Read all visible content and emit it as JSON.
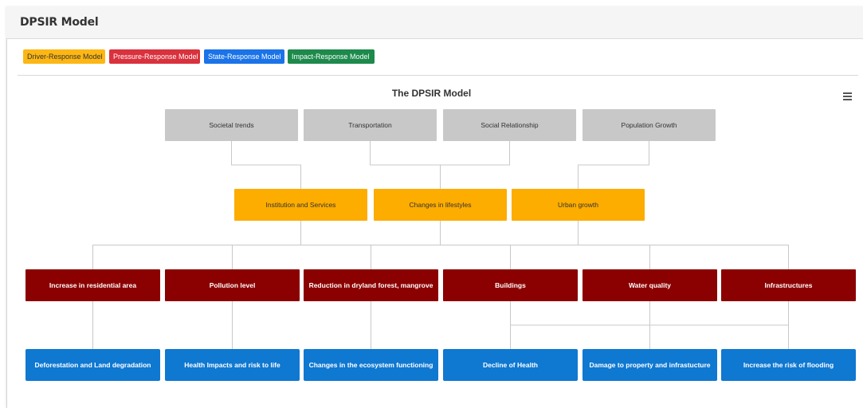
{
  "header": {
    "title": "DPSIR Model"
  },
  "toolbar": {
    "buttons": [
      {
        "label": "Driver-Response Model",
        "color": "#fdb714"
      },
      {
        "label": "Pressure-Response Model",
        "color": "#d9313d"
      },
      {
        "label": "State-Response Model",
        "color": "#1a73e8"
      },
      {
        "label": "Impact-Response Model",
        "color": "#1d8a4c"
      }
    ]
  },
  "chart": {
    "title": "The DPSIR Model",
    "menu_icon": "hamburger-menu-icon",
    "colors": {
      "drivers": "#c8c8c8",
      "pressures": "#fdac00",
      "states": "#8b0000",
      "impacts": "#0f78d1",
      "connector": "#c8c8c8"
    }
  },
  "chart_data": {
    "type": "organization",
    "levels": {
      "drivers": [
        "Societal trends",
        "Transportation",
        "Social Relationship",
        "Population Growth"
      ],
      "pressures": [
        "Institution and Services",
        "Changes in lifestyles",
        "Urban growth"
      ],
      "states": [
        "Increase in residential area",
        "Pollution level",
        "Reduction in dryland forest, mangrove",
        "Buildings",
        "Water quality",
        "Infrastructures"
      ],
      "impacts": [
        "Deforestation and Land degradation",
        "Health Impacts and risk to life",
        "Changes in the ecosystem functioning",
        "Decline of Health",
        "Damage to property and infrastucture",
        "Increase the risk of flooding"
      ]
    },
    "links": [
      [
        "Societal trends",
        "Institution and Services"
      ],
      [
        "Transportation",
        "Changes in lifestyles"
      ],
      [
        "Social Relationship",
        "Changes in lifestyles"
      ],
      [
        "Population Growth",
        "Urban growth"
      ],
      [
        "Institution and Services",
        "Increase in residential area"
      ],
      [
        "Institution and Services",
        "Pollution level"
      ],
      [
        "Institution and Services",
        "Reduction in dryland forest, mangrove"
      ],
      [
        "Changes in lifestyles",
        "Reduction in dryland forest, mangrove"
      ],
      [
        "Changes in lifestyles",
        "Buildings"
      ],
      [
        "Urban growth",
        "Buildings"
      ],
      [
        "Urban growth",
        "Water quality"
      ],
      [
        "Urban growth",
        "Infrastructures"
      ],
      [
        "Increase in residential area",
        "Deforestation and Land degradation"
      ],
      [
        "Pollution level",
        "Health Impacts and risk to life"
      ],
      [
        "Reduction in dryland forest, mangrove",
        "Changes in the ecosystem functioning"
      ],
      [
        "Buildings",
        "Decline of Health"
      ],
      [
        "Buildings",
        "Damage to property and infrastucture"
      ],
      [
        "Buildings",
        "Increase the risk of flooding"
      ],
      [
        "Water quality",
        "Damage to property and infrastucture"
      ],
      [
        "Infrastructures",
        "Increase the risk of flooding"
      ]
    ]
  }
}
